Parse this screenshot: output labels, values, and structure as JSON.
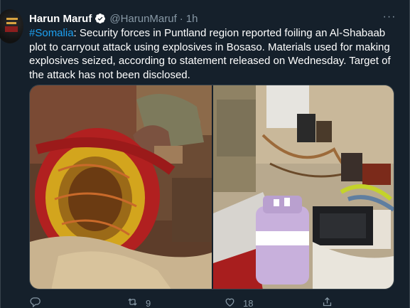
{
  "tweet": {
    "author_name": "Harun Maruf",
    "author_handle": "@HarunMaruf",
    "separator": "·",
    "time": "1h",
    "hashtag": "#Somalia",
    "text": ": Security forces in Puntland region reported foiling an Al-Shabaab plot to carryout attack using explosives in Bosaso. Materials used for making explosives seized, according to statement released on Wednesday. Target of the attack has not been disclosed.",
    "more_label": "···"
  },
  "actions": {
    "reply_count": "",
    "retweet_count": "9",
    "like_count": "18"
  },
  "colors": {
    "background": "#15202b",
    "accent": "#1da1f2",
    "muted": "#8899a6",
    "border": "#38444d"
  },
  "icons": [
    "verified-badge-icon",
    "more-icon",
    "reply-icon",
    "retweet-icon",
    "like-icon",
    "share-icon"
  ]
}
